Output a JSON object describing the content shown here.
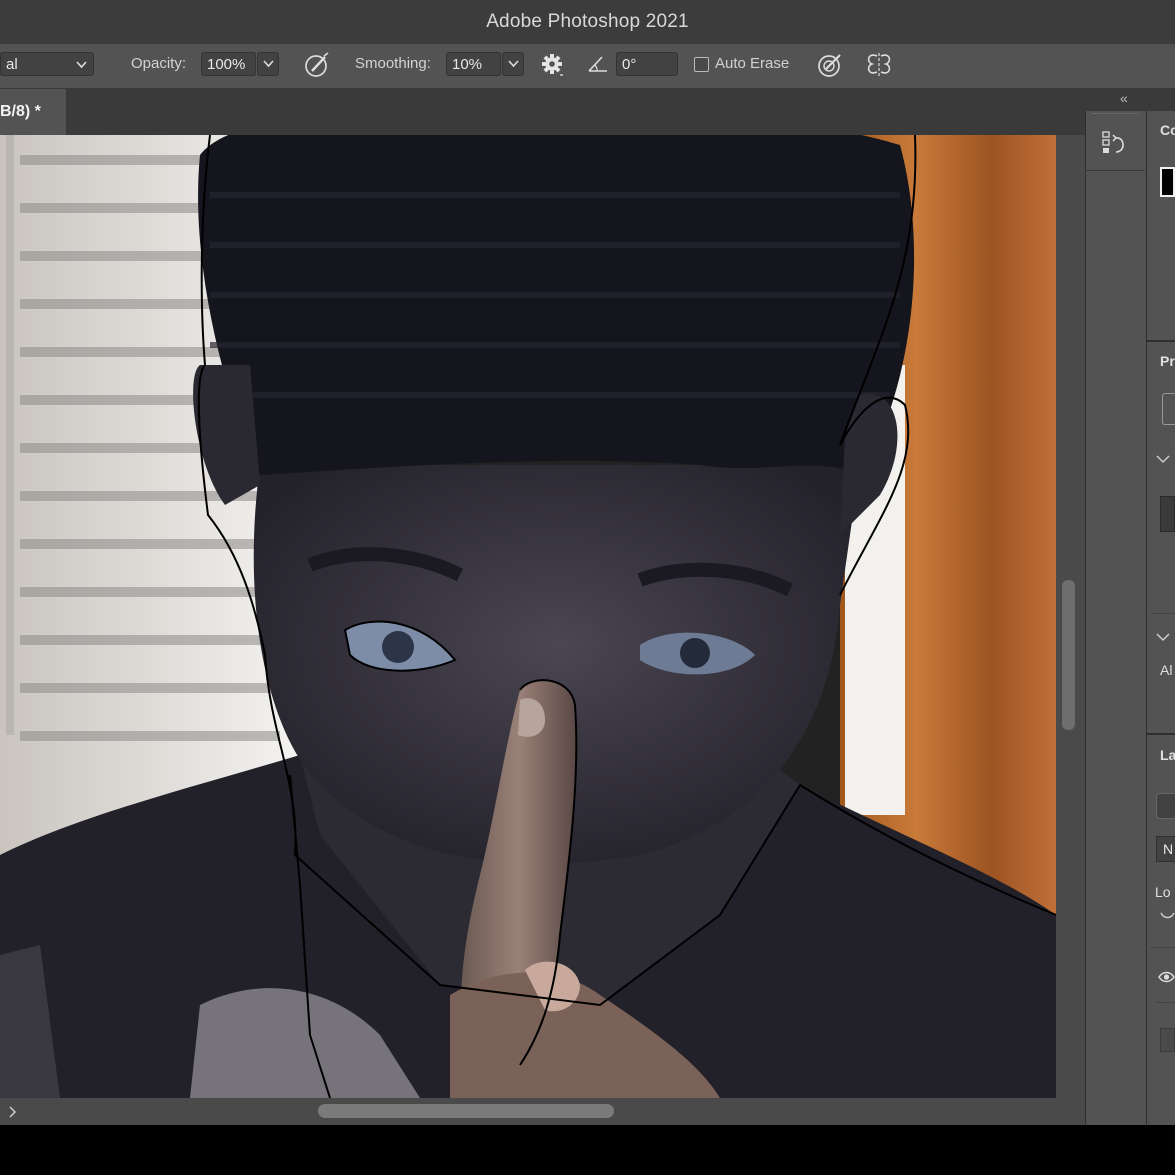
{
  "window": {
    "title": "Adobe Photoshop 2021"
  },
  "options_bar": {
    "mode_value": "al",
    "opacity_label": "Opacity:",
    "opacity_value": "100%",
    "smoothing_label": "Smoothing:",
    "smoothing_value": "10%",
    "angle_value": "0°",
    "auto_erase_label": "Auto Erase",
    "auto_erase_checked": false
  },
  "document": {
    "tab_label": "B/8) *"
  },
  "panels": {
    "collapse_glyph": "«",
    "color_title": "Co",
    "properties_title": "Pr",
    "align_label": "Al",
    "layers_title": "La",
    "blend_mode": "N",
    "lock_label": "Lo",
    "foreground_color": "#000000"
  },
  "icons": [
    "chevron-down-icon",
    "airbrush-pressure-icon",
    "gear-icon",
    "angle-icon",
    "size-pressure-icon",
    "symmetry-icon",
    "history-icon",
    "eye-icon",
    "chevron-right-icon"
  ],
  "colors": {
    "panel_bg": "#535353",
    "title_bg": "#3c3c3c",
    "field_bg": "#424242"
  }
}
